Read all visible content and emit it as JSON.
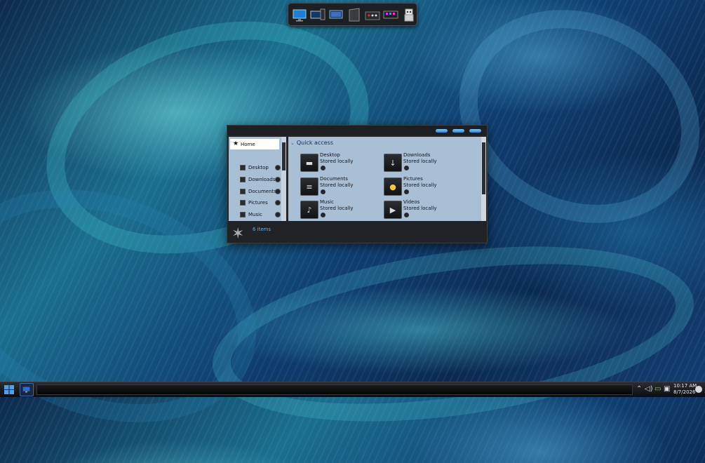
{
  "dock": {
    "icons": [
      "computer-icon",
      "workstation-icon",
      "media-center-icon",
      "tower-icon",
      "mixer-icon",
      "console-icon",
      "robot-icon"
    ]
  },
  "explorer": {
    "nav": {
      "home_label": "Home",
      "items": [
        {
          "label": "Desktop",
          "icon": "desktop-icon"
        },
        {
          "label": "Downloads",
          "icon": "downloads-icon"
        },
        {
          "label": "Documents",
          "icon": "documents-icon"
        },
        {
          "label": "Pictures",
          "icon": "pictures-icon"
        },
        {
          "label": "Music",
          "icon": "music-icon"
        }
      ]
    },
    "quick_access": {
      "title": "Quick access",
      "items": [
        {
          "name": "Desktop",
          "status": "Stored locally",
          "icon": "desktop-icon"
        },
        {
          "name": "Downloads",
          "status": "Stored locally",
          "icon": "downloads-icon"
        },
        {
          "name": "Documents",
          "status": "Stored locally",
          "icon": "documents-icon"
        },
        {
          "name": "Pictures",
          "status": "Stored locally",
          "icon": "pictures-icon"
        },
        {
          "name": "Music",
          "status": "Stored locally",
          "icon": "music-icon"
        },
        {
          "name": "Videos",
          "status": "Stored locally",
          "icon": "videos-icon"
        }
      ]
    },
    "status": {
      "item_count": "6 items"
    }
  },
  "taskbar": {
    "tray": [
      "chevron-up-icon",
      "volume-icon",
      "battery-icon",
      "network-icon"
    ],
    "clock": {
      "time": "10:17 AM",
      "date": "8/7/2026"
    }
  },
  "colors": {
    "accent": "#5fb3f0",
    "pane": "#a9bfd6",
    "window": "#232528"
  }
}
